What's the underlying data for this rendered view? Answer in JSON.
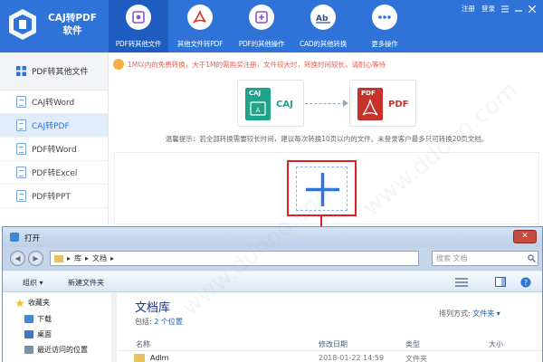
{
  "app": {
    "title": "CAJ转PDF软件",
    "top_links": {
      "register": "注册",
      "login": "登录"
    }
  },
  "nav": [
    {
      "label": "PDF转其他文件",
      "icon": "pdf-convert-icon",
      "active": true
    },
    {
      "label": "其他文件转PDF",
      "icon": "pdf-logo-icon",
      "active": false
    },
    {
      "label": "PDF的其他操作",
      "icon": "pdf-settings-icon",
      "active": false
    },
    {
      "label": "CAD的其他转换",
      "icon": "cad-icon",
      "active": false
    },
    {
      "label": "更多操作",
      "icon": "more-icon",
      "active": false
    }
  ],
  "sidebar": {
    "header": "PDF转其他文件",
    "items": [
      {
        "label": "CAJ转Word",
        "active": false
      },
      {
        "label": "CAJ转PDF",
        "active": true
      },
      {
        "label": "PDF转Word",
        "active": false
      },
      {
        "label": "PDF转Excel",
        "active": false
      },
      {
        "label": "PDF转PPT",
        "active": false
      }
    ]
  },
  "notice": "1M以内的免费转换，大于1M的需购买注册，文件较大时，转换时间较长，请耐心等待",
  "conversion": {
    "from_badge": "CAJ",
    "from_label": "CAJ",
    "to_badge": "PDF",
    "to_label": "PDF"
  },
  "tip": "温馨提示：若全部转换需要较长时间，建议每次转换10页以内的文件。未登录客户最多只可转换20页文档。",
  "dialog": {
    "title": "打开",
    "close_glyph": "✕",
    "path": [
      "库",
      "文档"
    ],
    "search_placeholder": "搜索 文档",
    "toolbar": {
      "organize": "组织 ▾",
      "new_folder": "新建文件夹"
    },
    "tree": [
      {
        "label": "收藏夹",
        "icon": "favorites-icon",
        "color": "#f1c232"
      },
      {
        "label": "下载",
        "icon": "download-folder-icon",
        "color": "#4a86d0"
      },
      {
        "label": "桌面",
        "icon": "desktop-icon",
        "color": "#3c78c3"
      },
      {
        "label": "最近访问的位置",
        "icon": "recent-places-icon",
        "color": "#7a8fa6"
      }
    ],
    "library": {
      "title": "文档库",
      "includes_label": "包括:",
      "includes_link": "2 个位置",
      "arrange_label": "排列方式:",
      "arrange_value": "文件夹 ▾"
    },
    "columns": {
      "name": "名称",
      "modified": "修改日期",
      "type": "类型",
      "size": "大小"
    },
    "rows": [
      {
        "name": "Adlm",
        "modified": "2018-01-22 14:59",
        "type": "文件夹"
      }
    ]
  },
  "watermark": "www.ddooo.com",
  "colors": {
    "brand_blue": "#2f73d9",
    "accent_red": "#e02020",
    "caj_green": "#1fa38a",
    "pdf_red": "#c8302a"
  }
}
